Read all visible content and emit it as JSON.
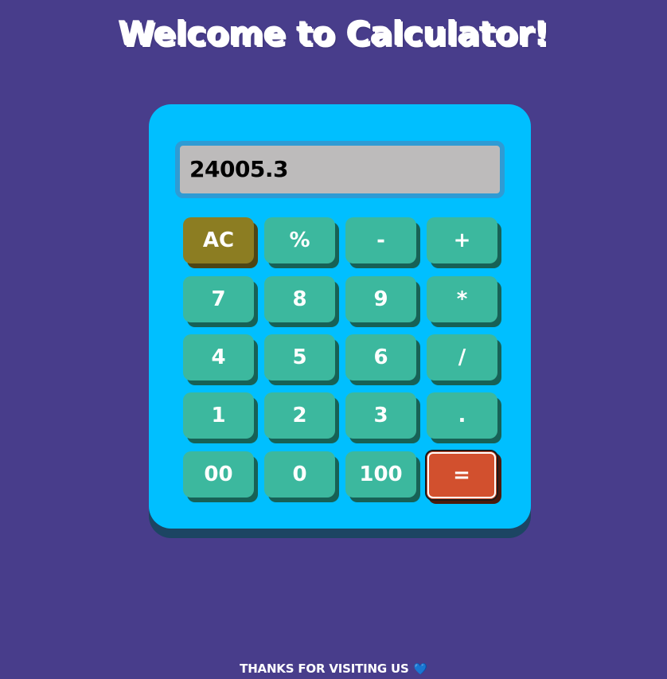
{
  "header": {
    "title": "Welcome to Calculator!"
  },
  "calculator": {
    "display_value": "24005.3",
    "keys": [
      {
        "label": "AC",
        "name": "clear-button",
        "type": "clear"
      },
      {
        "label": "%",
        "name": "percent-button",
        "type": "operator"
      },
      {
        "label": "-",
        "name": "minus-button",
        "type": "operator"
      },
      {
        "label": "+",
        "name": "plus-button",
        "type": "operator"
      },
      {
        "label": "7",
        "name": "digit-7-button",
        "type": "digit"
      },
      {
        "label": "8",
        "name": "digit-8-button",
        "type": "digit"
      },
      {
        "label": "9",
        "name": "digit-9-button",
        "type": "digit"
      },
      {
        "label": "*",
        "name": "multiply-button",
        "type": "operator"
      },
      {
        "label": "4",
        "name": "digit-4-button",
        "type": "digit"
      },
      {
        "label": "5",
        "name": "digit-5-button",
        "type": "digit"
      },
      {
        "label": "6",
        "name": "digit-6-button",
        "type": "digit"
      },
      {
        "label": "/",
        "name": "divide-button",
        "type": "operator"
      },
      {
        "label": "1",
        "name": "digit-1-button",
        "type": "digit"
      },
      {
        "label": "2",
        "name": "digit-2-button",
        "type": "digit"
      },
      {
        "label": "3",
        "name": "digit-3-button",
        "type": "digit"
      },
      {
        "label": ".",
        "name": "decimal-button",
        "type": "operator"
      },
      {
        "label": "00",
        "name": "double-zero-button",
        "type": "digit"
      },
      {
        "label": "0",
        "name": "digit-0-button",
        "type": "digit"
      },
      {
        "label": "100",
        "name": "hundred-button",
        "type": "digit"
      },
      {
        "label": "=",
        "name": "equals-button",
        "type": "equals"
      }
    ]
  },
  "footer": {
    "text": "THANKS FOR VISITING US",
    "icon": "heart-icon",
    "icon_glyph": "💙"
  },
  "colors": {
    "background": "#483d8b",
    "calculator_body": "#00bfff",
    "key": "#3cb89e",
    "clear_key": "#8c7d22",
    "equals_key": "#d2502e",
    "display": "#bdbbbb"
  }
}
